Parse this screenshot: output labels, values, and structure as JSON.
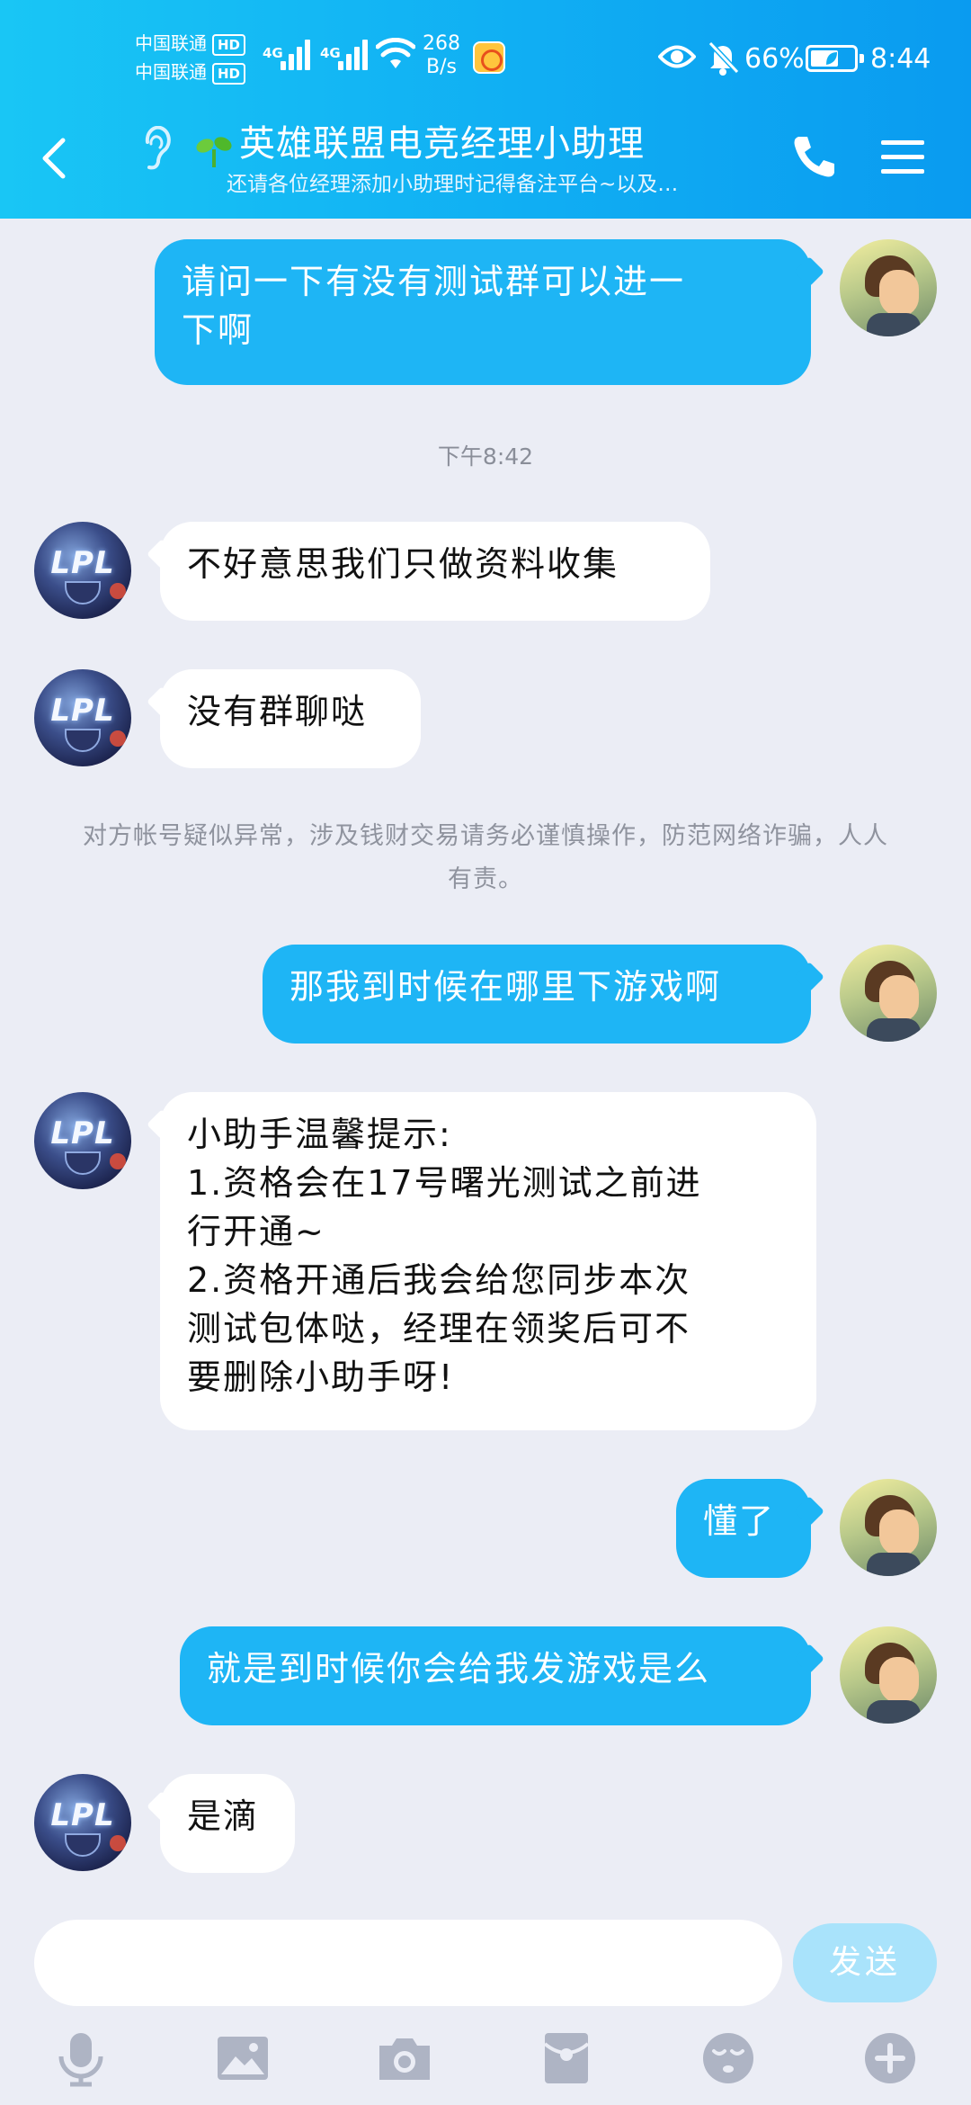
{
  "status_bar": {
    "carrier1": "中国联通",
    "carrier2": "中国联通",
    "hd": "HD",
    "net1": "4G",
    "net2": "4G",
    "speed_value": "268",
    "speed_unit": "B/s",
    "battery_percent": "66%",
    "battery_level": 0.66,
    "time": "8:44"
  },
  "header": {
    "title": "英雄联盟电竞经理小助理",
    "subtitle": "还请各位经理添加小助理时记得备注平台~以及…"
  },
  "messages": [
    {
      "sender": "me",
      "text": "请问一下有没有测试群可以进一\n下啊"
    },
    {
      "type": "time",
      "text": "下午8:42"
    },
    {
      "sender": "other",
      "text": "不好意思我们只做资料收集"
    },
    {
      "sender": "other",
      "text": "没有群聊哒"
    },
    {
      "type": "notice",
      "text": "对方帐号疑似异常，涉及钱财交易请务必谨慎操作，防范网络诈骗，人人有责。"
    },
    {
      "sender": "me",
      "text": "那我到时候在哪里下游戏啊"
    },
    {
      "sender": "other",
      "text": "小助手温馨提示:\n1.资格会在17号曙光测试之前进\n行开通~\n2.资格开通后我会给您同步本次\n测试包体哒，经理在领奖后可不\n要删除小助手呀!"
    },
    {
      "sender": "me",
      "text": "懂了"
    },
    {
      "sender": "me",
      "text": "就是到时候你会给我发游戏是么"
    },
    {
      "sender": "other",
      "text": "是滴"
    }
  ],
  "avatar_other_text": "LPL",
  "input": {
    "value": "",
    "send_label": "发送"
  },
  "toolbar": [
    "microphone-icon",
    "image-icon",
    "camera-icon",
    "red-packet-icon",
    "emoji-icon",
    "plus-icon"
  ],
  "colors": {
    "header": "#10AEF3",
    "bubble_out": "#1EB5F5",
    "bubble_in": "#FFFFFF",
    "background": "#EBEDF5",
    "send_button": "#A9E3FB"
  }
}
